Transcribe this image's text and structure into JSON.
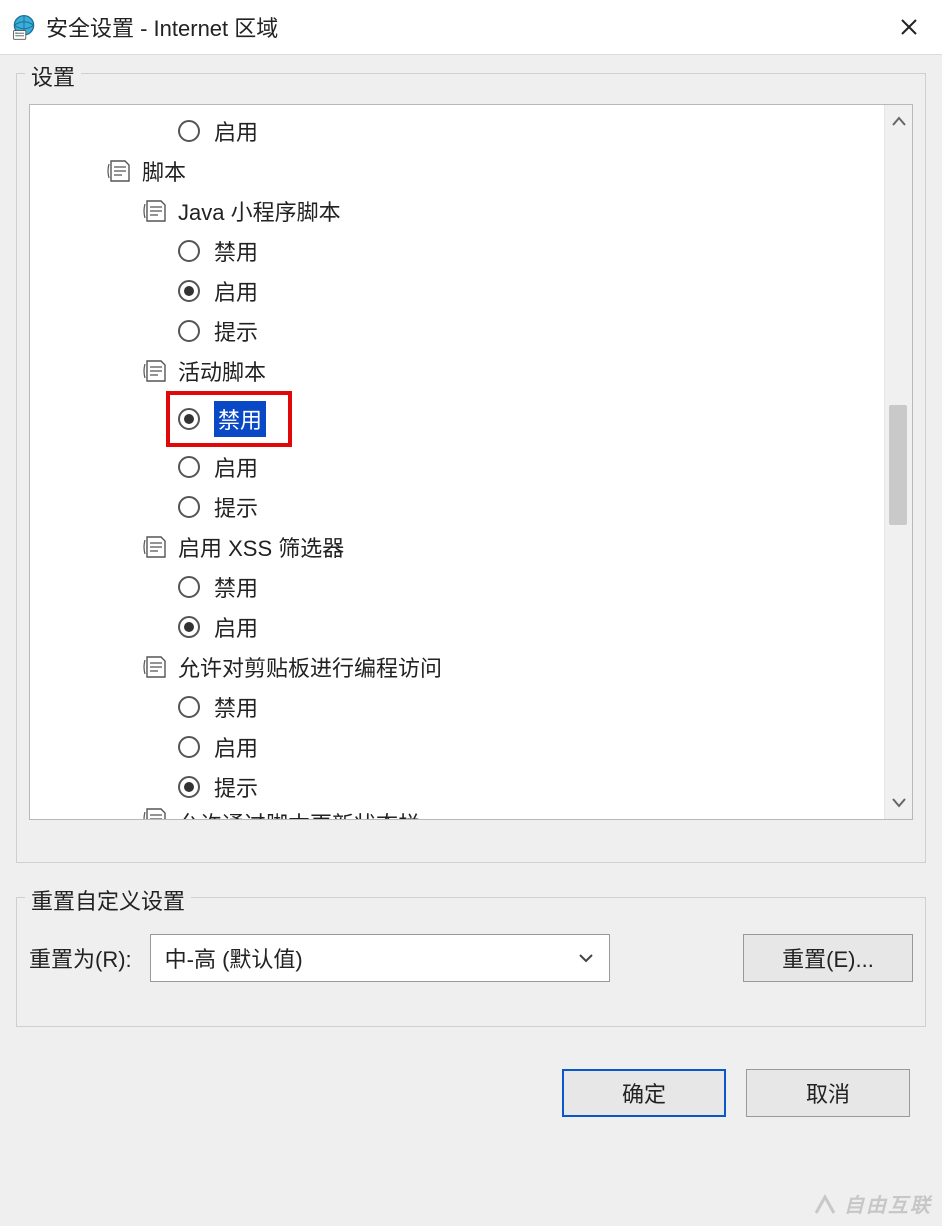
{
  "window": {
    "title": "安全设置 - Internet 区域"
  },
  "settings_group": {
    "legend": "设置"
  },
  "tree": {
    "orphan_option": {
      "label": "启用",
      "checked": false
    },
    "category": {
      "label": "脚本"
    },
    "sub1": {
      "label": "Java 小程序脚本",
      "options": [
        {
          "label": "禁用",
          "checked": false
        },
        {
          "label": "启用",
          "checked": true
        },
        {
          "label": "提示",
          "checked": false
        }
      ]
    },
    "sub2": {
      "label": "活动脚本",
      "options": [
        {
          "label": "禁用",
          "checked": true,
          "highlighted": true
        },
        {
          "label": "启用",
          "checked": false
        },
        {
          "label": "提示",
          "checked": false
        }
      ]
    },
    "sub3": {
      "label": "启用 XSS 筛选器",
      "options": [
        {
          "label": "禁用",
          "checked": false
        },
        {
          "label": "启用",
          "checked": true
        }
      ]
    },
    "sub4": {
      "label": "允许对剪贴板进行编程访问",
      "options": [
        {
          "label": "禁用",
          "checked": false
        },
        {
          "label": "启用",
          "checked": false
        },
        {
          "label": "提示",
          "checked": true
        }
      ]
    },
    "truncated": {
      "label": "允许通过脚本更新状态栏"
    }
  },
  "reset_group": {
    "legend": "重置自定义设置",
    "label": "重置为(R):",
    "dropdown_value": "中-高 (默认值)",
    "reset_button": "重置(E)..."
  },
  "buttons": {
    "ok": "确定",
    "cancel": "取消"
  },
  "watermark": "自由互联"
}
